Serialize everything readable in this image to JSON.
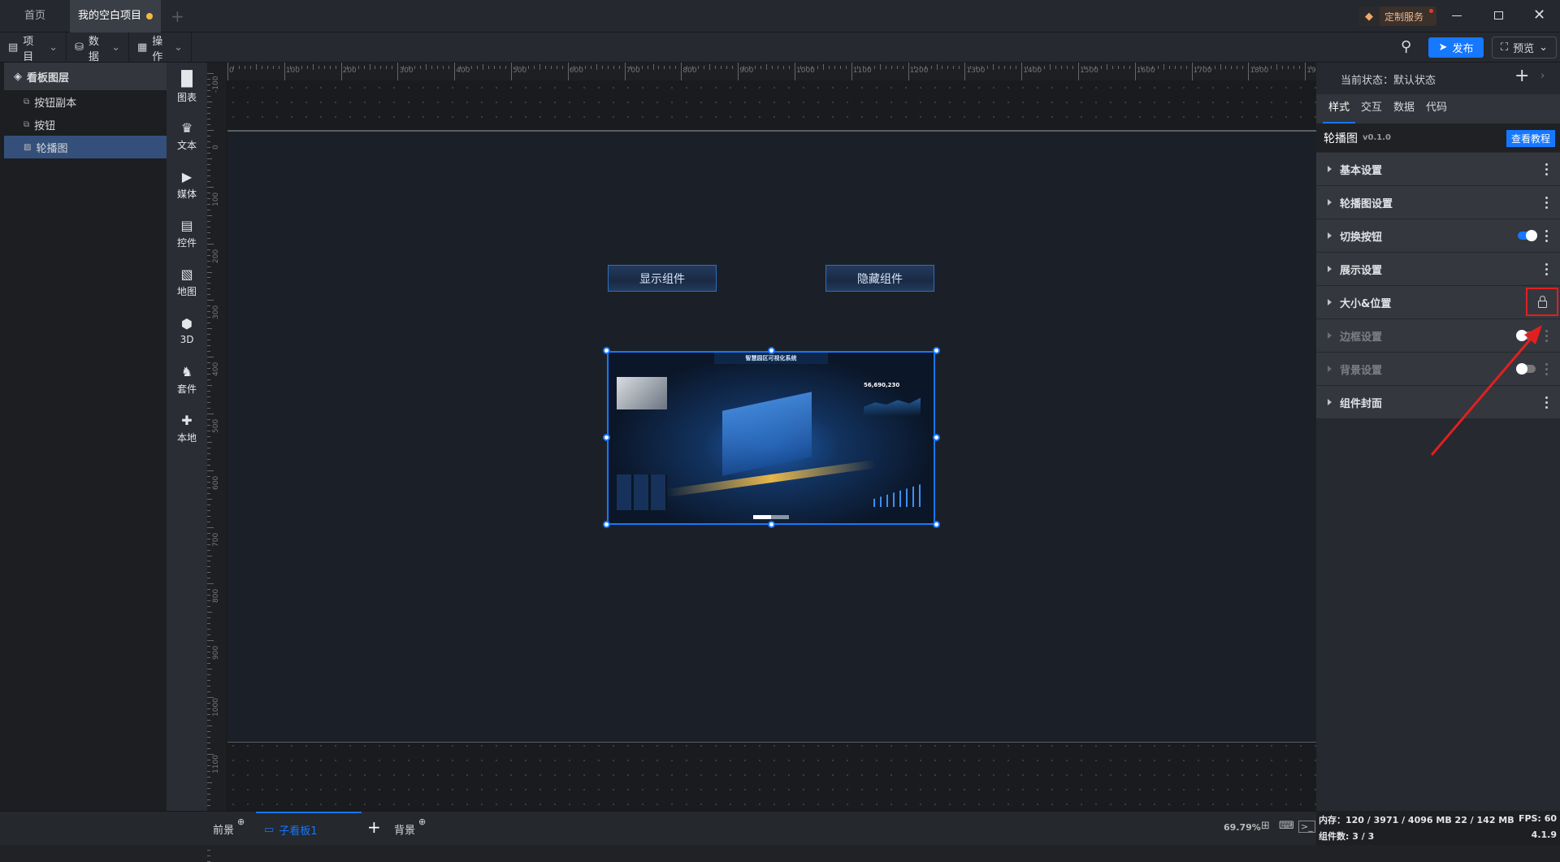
{
  "window": {
    "tabs": [
      {
        "label": "首页",
        "active": false
      },
      {
        "label": "我的空白项目",
        "active": true,
        "unsaved": true
      }
    ],
    "custom_service": "定制服务"
  },
  "toolbar": {
    "menus": [
      {
        "label": "项目",
        "icon": "file-icon"
      },
      {
        "label": "数据",
        "icon": "database-icon"
      },
      {
        "label": "操作",
        "icon": "grid-icon"
      }
    ],
    "publish": "发布",
    "preview": "预览",
    "accent": "#1677ff"
  },
  "layers": {
    "title": "看板图层",
    "items": [
      {
        "label": "按钮副本",
        "icon": "button-layer-icon"
      },
      {
        "label": "按钮",
        "icon": "button-layer-icon"
      },
      {
        "label": "轮播图",
        "icon": "image-layer-icon",
        "selected": true
      }
    ]
  },
  "components": [
    {
      "label": "图表",
      "icon": "chart-icon"
    },
    {
      "label": "文本",
      "icon": "text-icon"
    },
    {
      "label": "媒体",
      "icon": "media-icon"
    },
    {
      "label": "控件",
      "icon": "control-icon"
    },
    {
      "label": "地图",
      "icon": "map-icon"
    },
    {
      "label": "3D",
      "icon": "cube-icon"
    },
    {
      "label": "套件",
      "icon": "shirt-icon"
    },
    {
      "label": "本地",
      "icon": "puzzle-icon"
    }
  ],
  "ruler": {
    "top": [
      "0",
      "100",
      "200",
      "300",
      "400",
      "500",
      "600",
      "700",
      "800",
      "900",
      "1000",
      "1100",
      "1200",
      "1300",
      "1400",
      "1500",
      "1600",
      "1700",
      "1800",
      "1900"
    ],
    "left": [
      "-100",
      "0",
      "100",
      "200",
      "300",
      "400",
      "500",
      "600",
      "700",
      "800",
      "900",
      "1000",
      "1100",
      "1200"
    ]
  },
  "canvas": {
    "show_button": "显示组件",
    "hide_button": "隐藏组件",
    "carousel_title": "智慧园区可视化系统",
    "carousel_value": "56,690,230"
  },
  "right_panel": {
    "state_label": "当前状态：",
    "state_value": "默认状态",
    "tabs": [
      "样式",
      "交互",
      "数据",
      "代码"
    ],
    "active_tab": 0,
    "component_name": "轮播图",
    "version": "v0.1.0",
    "tutorial": "查看教程",
    "sections": [
      {
        "label": "基本设置"
      },
      {
        "label": "轮播图设置"
      },
      {
        "label": "切换按钮",
        "toggle": true
      },
      {
        "label": "展示设置"
      },
      {
        "label": "大小&位置",
        "locked": true
      },
      {
        "label": "边框设置",
        "toggle": false,
        "disabled": true
      },
      {
        "label": "背景设置",
        "toggle": false,
        "disabled": true
      },
      {
        "label": "组件封面"
      }
    ]
  },
  "bottom": {
    "foreground": "前景",
    "sub_board": "子看板1",
    "background": "背景",
    "zoom": "69.79%"
  },
  "status": {
    "memory_label": "内存：",
    "memory": "120 / 3971 / 4096 MB  22 / 142 MB",
    "fps_label": "FPS:",
    "fps": "60",
    "count_label": "组件数:",
    "count": "3 / 3",
    "version": "4.1.9"
  }
}
